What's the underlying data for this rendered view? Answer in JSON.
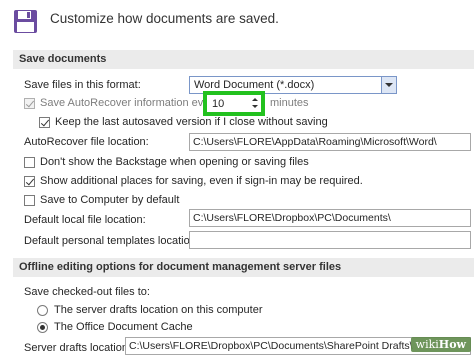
{
  "header": {
    "icon": "save-floppy-icon",
    "title": "Customize how documents are saved."
  },
  "save_documents": {
    "section_title": "Save documents",
    "format_label": "Save files in this format:",
    "format_value": "Word Document (*.docx)",
    "autorecover_label": "Save AutoRecover information every",
    "autorecover_checked": true,
    "autorecover_minutes": "10",
    "minutes_label": "minutes",
    "keep_last_label": "Keep the last autosaved version if I close without saving",
    "keep_last_checked": true,
    "autorecover_location_label": "AutoRecover file location:",
    "autorecover_location_value": "C:\\Users\\FLORE\\AppData\\Roaming\\Microsoft\\Word\\",
    "backstage_label": "Don't show the Backstage when opening or saving files",
    "backstage_checked": false,
    "additional_places_label": "Show additional places for saving, even if sign-in may be required.",
    "additional_places_checked": true,
    "save_to_computer_label": "Save to Computer by default",
    "save_to_computer_checked": false,
    "default_local_label": "Default local file location:",
    "default_local_value": "C:\\Users\\FLORE\\Dropbox\\PC\\Documents\\",
    "templates_label": "Default personal templates location:",
    "templates_value": ""
  },
  "offline": {
    "section_title": "Offline editing options for document management server files",
    "save_checked_out_label": "Save checked-out files to:",
    "option_server_drafts": "The server drafts location on this computer",
    "option_cache": "The Office Document Cache",
    "selected": "cache",
    "server_drafts_label": "Server drafts location:",
    "server_drafts_value": "C:\\Users\\FLORE\\Dropbox\\PC\\Documents\\SharePoint Drafts\\"
  },
  "watermark": {
    "text_wiki": "wiki",
    "text_how": "How"
  },
  "colors": {
    "highlight_green": "#22c11e",
    "section_bg": "#ebebeb"
  }
}
